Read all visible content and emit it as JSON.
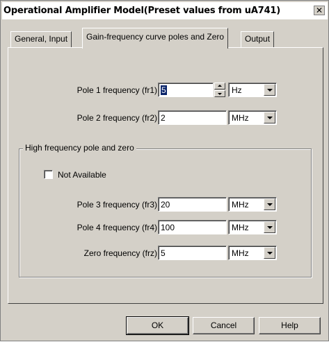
{
  "window": {
    "title": "Operational Amplifier Model(Preset values from uA741)",
    "close_symbol": "✕"
  },
  "tabs": [
    {
      "label": "General, Input",
      "active": false
    },
    {
      "label": "Gain-frequency curve poles and Zero",
      "active": true
    },
    {
      "label": "Output",
      "active": false
    }
  ],
  "fields": {
    "pole1": {
      "label": "Pole 1 frequency (fr1)",
      "value": "5",
      "unit": "Hz"
    },
    "pole2": {
      "label": "Pole 2 frequency (fr2)",
      "value": "2",
      "unit": "MHz"
    },
    "pole3": {
      "label": "Pole 3 frequency (fr3)",
      "value": "20",
      "unit": "MHz"
    },
    "pole4": {
      "label": "Pole 4 frequency (fr4)",
      "value": "100",
      "unit": "MHz"
    },
    "zero": {
      "label": "Zero frequency (frz)",
      "value": "5",
      "unit": "MHz"
    }
  },
  "group": {
    "title": "High frequency pole and zero",
    "not_available_label": "Not Available",
    "not_available_checked": false
  },
  "buttons": {
    "ok": "OK",
    "cancel": "Cancel",
    "help": "Help"
  },
  "colors": {
    "face": "#d4d0c8",
    "selection": "#0a246a"
  }
}
